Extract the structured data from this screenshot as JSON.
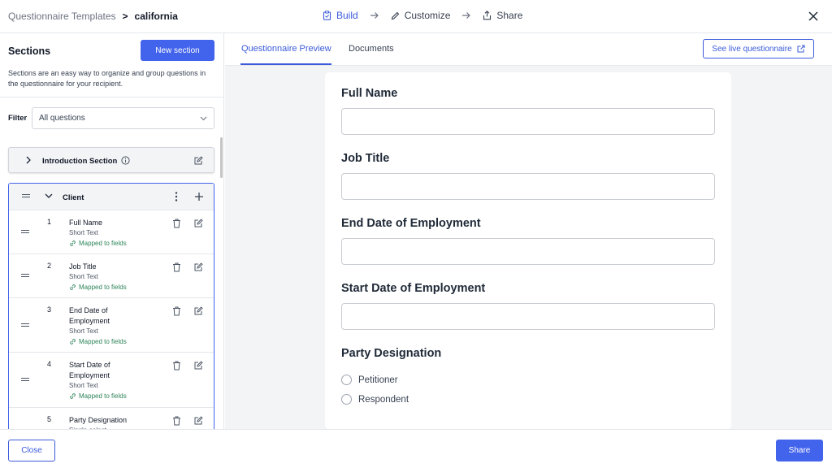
{
  "breadcrumb": {
    "parent": "Questionnaire Templates",
    "separator": ">",
    "current": "california"
  },
  "steps": [
    {
      "label": "Build",
      "icon": "clipboard-icon",
      "active": true
    },
    {
      "label": "Customize",
      "icon": "pencil-icon",
      "active": false
    },
    {
      "label": "Share",
      "icon": "share-icon",
      "active": false
    }
  ],
  "sidebar": {
    "title": "Sections",
    "new_section_label": "New section",
    "description": "Sections are an easy way to organize and group questions in the questionnaire for your recipient.",
    "filter_label": "Filter",
    "filter_value": "All questions",
    "intro_section": {
      "label": "Introduction Section"
    },
    "client_section": {
      "label": "Client",
      "questions": [
        {
          "num": "1",
          "title": "Full Name",
          "type": "Short Text",
          "mapped": "Mapped to fields"
        },
        {
          "num": "2",
          "title": "Job Title",
          "type": "Short Text",
          "mapped": "Mapped to fields"
        },
        {
          "num": "3",
          "title": "End Date of Employment",
          "type": "Short Text",
          "mapped": "Mapped to fields"
        },
        {
          "num": "4",
          "title": "Start Date of Employment",
          "type": "Short Text",
          "mapped": "Mapped to fields"
        },
        {
          "num": "5",
          "title": "Party Designation",
          "type": "Single-select",
          "mapped": ""
        }
      ]
    }
  },
  "preview": {
    "tabs": [
      {
        "label": "Questionnaire Preview",
        "active": true
      },
      {
        "label": "Documents",
        "active": false
      }
    ],
    "live_button": "See live questionnaire",
    "fields": [
      {
        "label": "Full Name"
      },
      {
        "label": "Job Title"
      },
      {
        "label": "End Date of Employment"
      },
      {
        "label": "Start Date of Employment"
      }
    ],
    "radio_question": {
      "label": "Party Designation",
      "options": [
        "Petitioner",
        "Respondent"
      ]
    }
  },
  "footer": {
    "close_label": "Close",
    "share_label": "Share"
  },
  "colors": {
    "accent": "#4263eb",
    "mapped": "#2f855a",
    "panel_bg": "#f3f4f6"
  }
}
